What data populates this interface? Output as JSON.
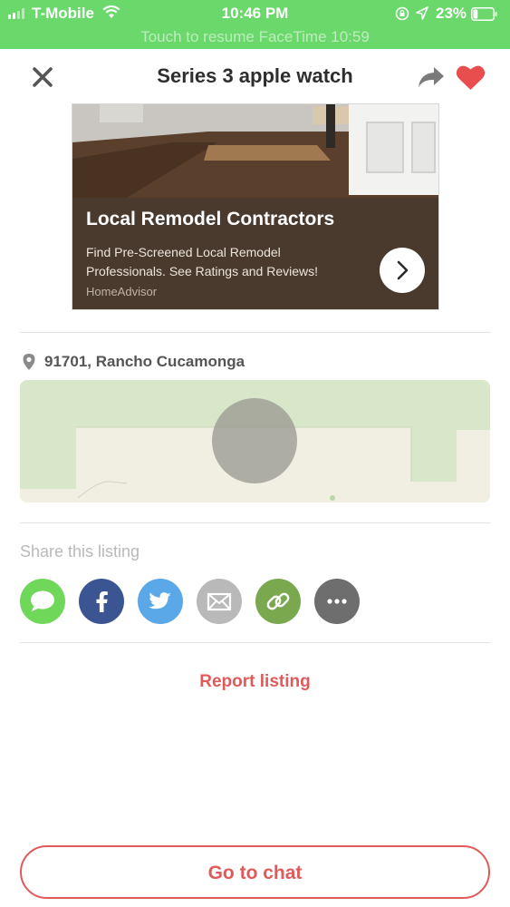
{
  "status_bar": {
    "carrier": "T-Mobile",
    "time": "10:46 PM",
    "battery_percent": "23%",
    "battery_level": 0.23,
    "facetime_banner": "Touch to resume FaceTime 10:59",
    "icons": [
      "signal-icon",
      "wifi-icon",
      "rotation-lock-icon",
      "location-arrow-icon",
      "battery-icon"
    ]
  },
  "header": {
    "title": "Series 3 apple watch",
    "icons": [
      "close-icon",
      "share-arrow-icon",
      "heart-icon"
    ]
  },
  "ad": {
    "title": "Local Remodel Contractors",
    "body": "Find Pre-Screened Local Remodel Professionals. See Ratings and Reviews!",
    "brand": "HomeAdvisor",
    "icon": "chevron-right-icon"
  },
  "location": {
    "text": "91701, Rancho Cucamonga",
    "icon": "map-pin-icon"
  },
  "share": {
    "heading": "Share this listing",
    "buttons": [
      {
        "name": "messages",
        "icon": "speech-bubble-icon",
        "color": "#6fd85a"
      },
      {
        "name": "facebook",
        "icon": "facebook-icon",
        "color": "#3b5592"
      },
      {
        "name": "twitter",
        "icon": "twitter-bird-icon",
        "color": "#5aa8e8"
      },
      {
        "name": "email",
        "icon": "envelope-icon",
        "color": "#b9b9b9"
      },
      {
        "name": "copy-link",
        "icon": "link-icon",
        "color": "#7aa84f"
      },
      {
        "name": "more",
        "icon": "more-dots-icon",
        "color": "#6e6e6e"
      }
    ]
  },
  "report_label": "Report listing",
  "chat_label": "Go to chat",
  "colors": {
    "status_bar_green": "#6bd86b",
    "accent_red": "#e05a5a",
    "ad_panel": "#4a3a2e"
  }
}
